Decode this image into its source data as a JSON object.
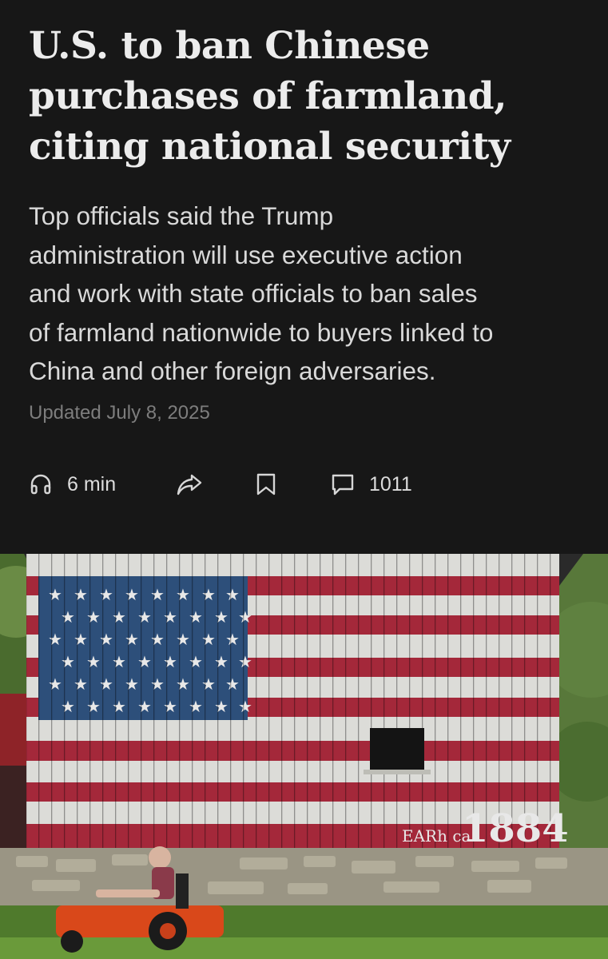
{
  "article": {
    "headline_lines": [
      "U.S. to ban Chinese",
      "purchases of farmland,",
      "citing national security"
    ],
    "dek_lines": [
      "Top officials said the Trump",
      "administration will use executive action",
      "and work with state officials to ban sales",
      "of farmland nationwide to buyers linked to",
      "China and other foreign adversaries."
    ],
    "timestamp": "Updated July 8, 2025"
  },
  "actions": {
    "listen": {
      "icon": "headphones-icon",
      "label": "6 min"
    },
    "share": {
      "icon": "share-arrow-icon"
    },
    "save": {
      "icon": "bookmark-icon"
    },
    "comments": {
      "icon": "comment-bubble-icon",
      "label": "1011"
    }
  },
  "photo": {
    "barn_text": "EARh ca",
    "barn_year": "1884"
  },
  "colors": {
    "background": "#171717",
    "headline": "#ececec",
    "dek": "#d9d9d9",
    "timestamp": "#7d7d7d",
    "flag_red": "#a4283a",
    "flag_blue": "#2d4f7a"
  }
}
